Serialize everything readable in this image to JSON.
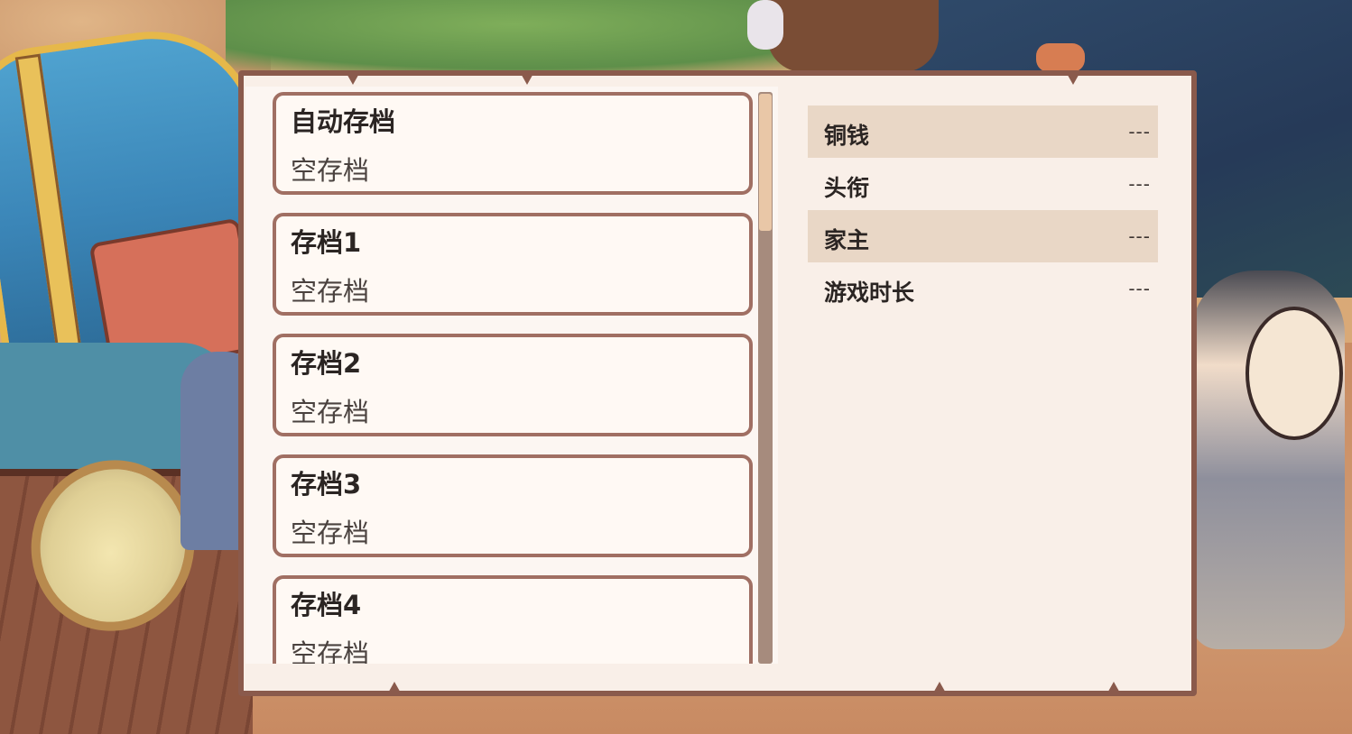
{
  "save_slots": [
    {
      "title": "自动存档",
      "status": "空存档"
    },
    {
      "title": "存档1",
      "status": "空存档"
    },
    {
      "title": "存档2",
      "status": "空存档"
    },
    {
      "title": "存档3",
      "status": "空存档"
    },
    {
      "title": "存档4",
      "status": "空存档"
    }
  ],
  "details": [
    {
      "label": "铜钱",
      "value": "---"
    },
    {
      "label": "头衔",
      "value": "---"
    },
    {
      "label": "家主",
      "value": "---"
    },
    {
      "label": "游戏时长",
      "value": "---"
    }
  ],
  "colors": {
    "panel_border": "#8a5a4c",
    "panel_bg": "#f9efe8",
    "slot_border": "#a06f63",
    "row_highlight": "#e9d7c6",
    "scroll_thumb": "#e9c7a7"
  }
}
